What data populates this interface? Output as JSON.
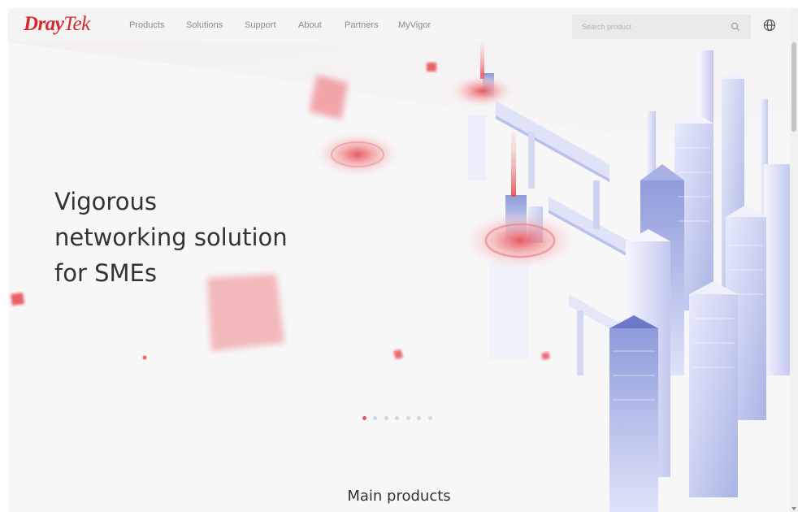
{
  "brand": {
    "logo_part1": "Dray",
    "logo_part2": "Tek",
    "color": "#d8282e"
  },
  "nav": {
    "items": [
      {
        "label": "Products"
      },
      {
        "label": "Solutions"
      },
      {
        "label": "Support"
      },
      {
        "label": "About"
      },
      {
        "label": "Partners"
      },
      {
        "label": "MyVigor"
      }
    ]
  },
  "search": {
    "placeholder": "Search product",
    "icon": "search-icon"
  },
  "language": {
    "icon": "globe-icon"
  },
  "hero": {
    "title_lines": [
      "Vigorous",
      "networking solution",
      "for SMEs"
    ],
    "slides": {
      "count": 7,
      "active": 1
    }
  },
  "section": {
    "main_products_label": "Main products"
  },
  "colors": {
    "accent": "#e05a5e",
    "text": "#333333",
    "nav_text": "#8b8b90"
  }
}
